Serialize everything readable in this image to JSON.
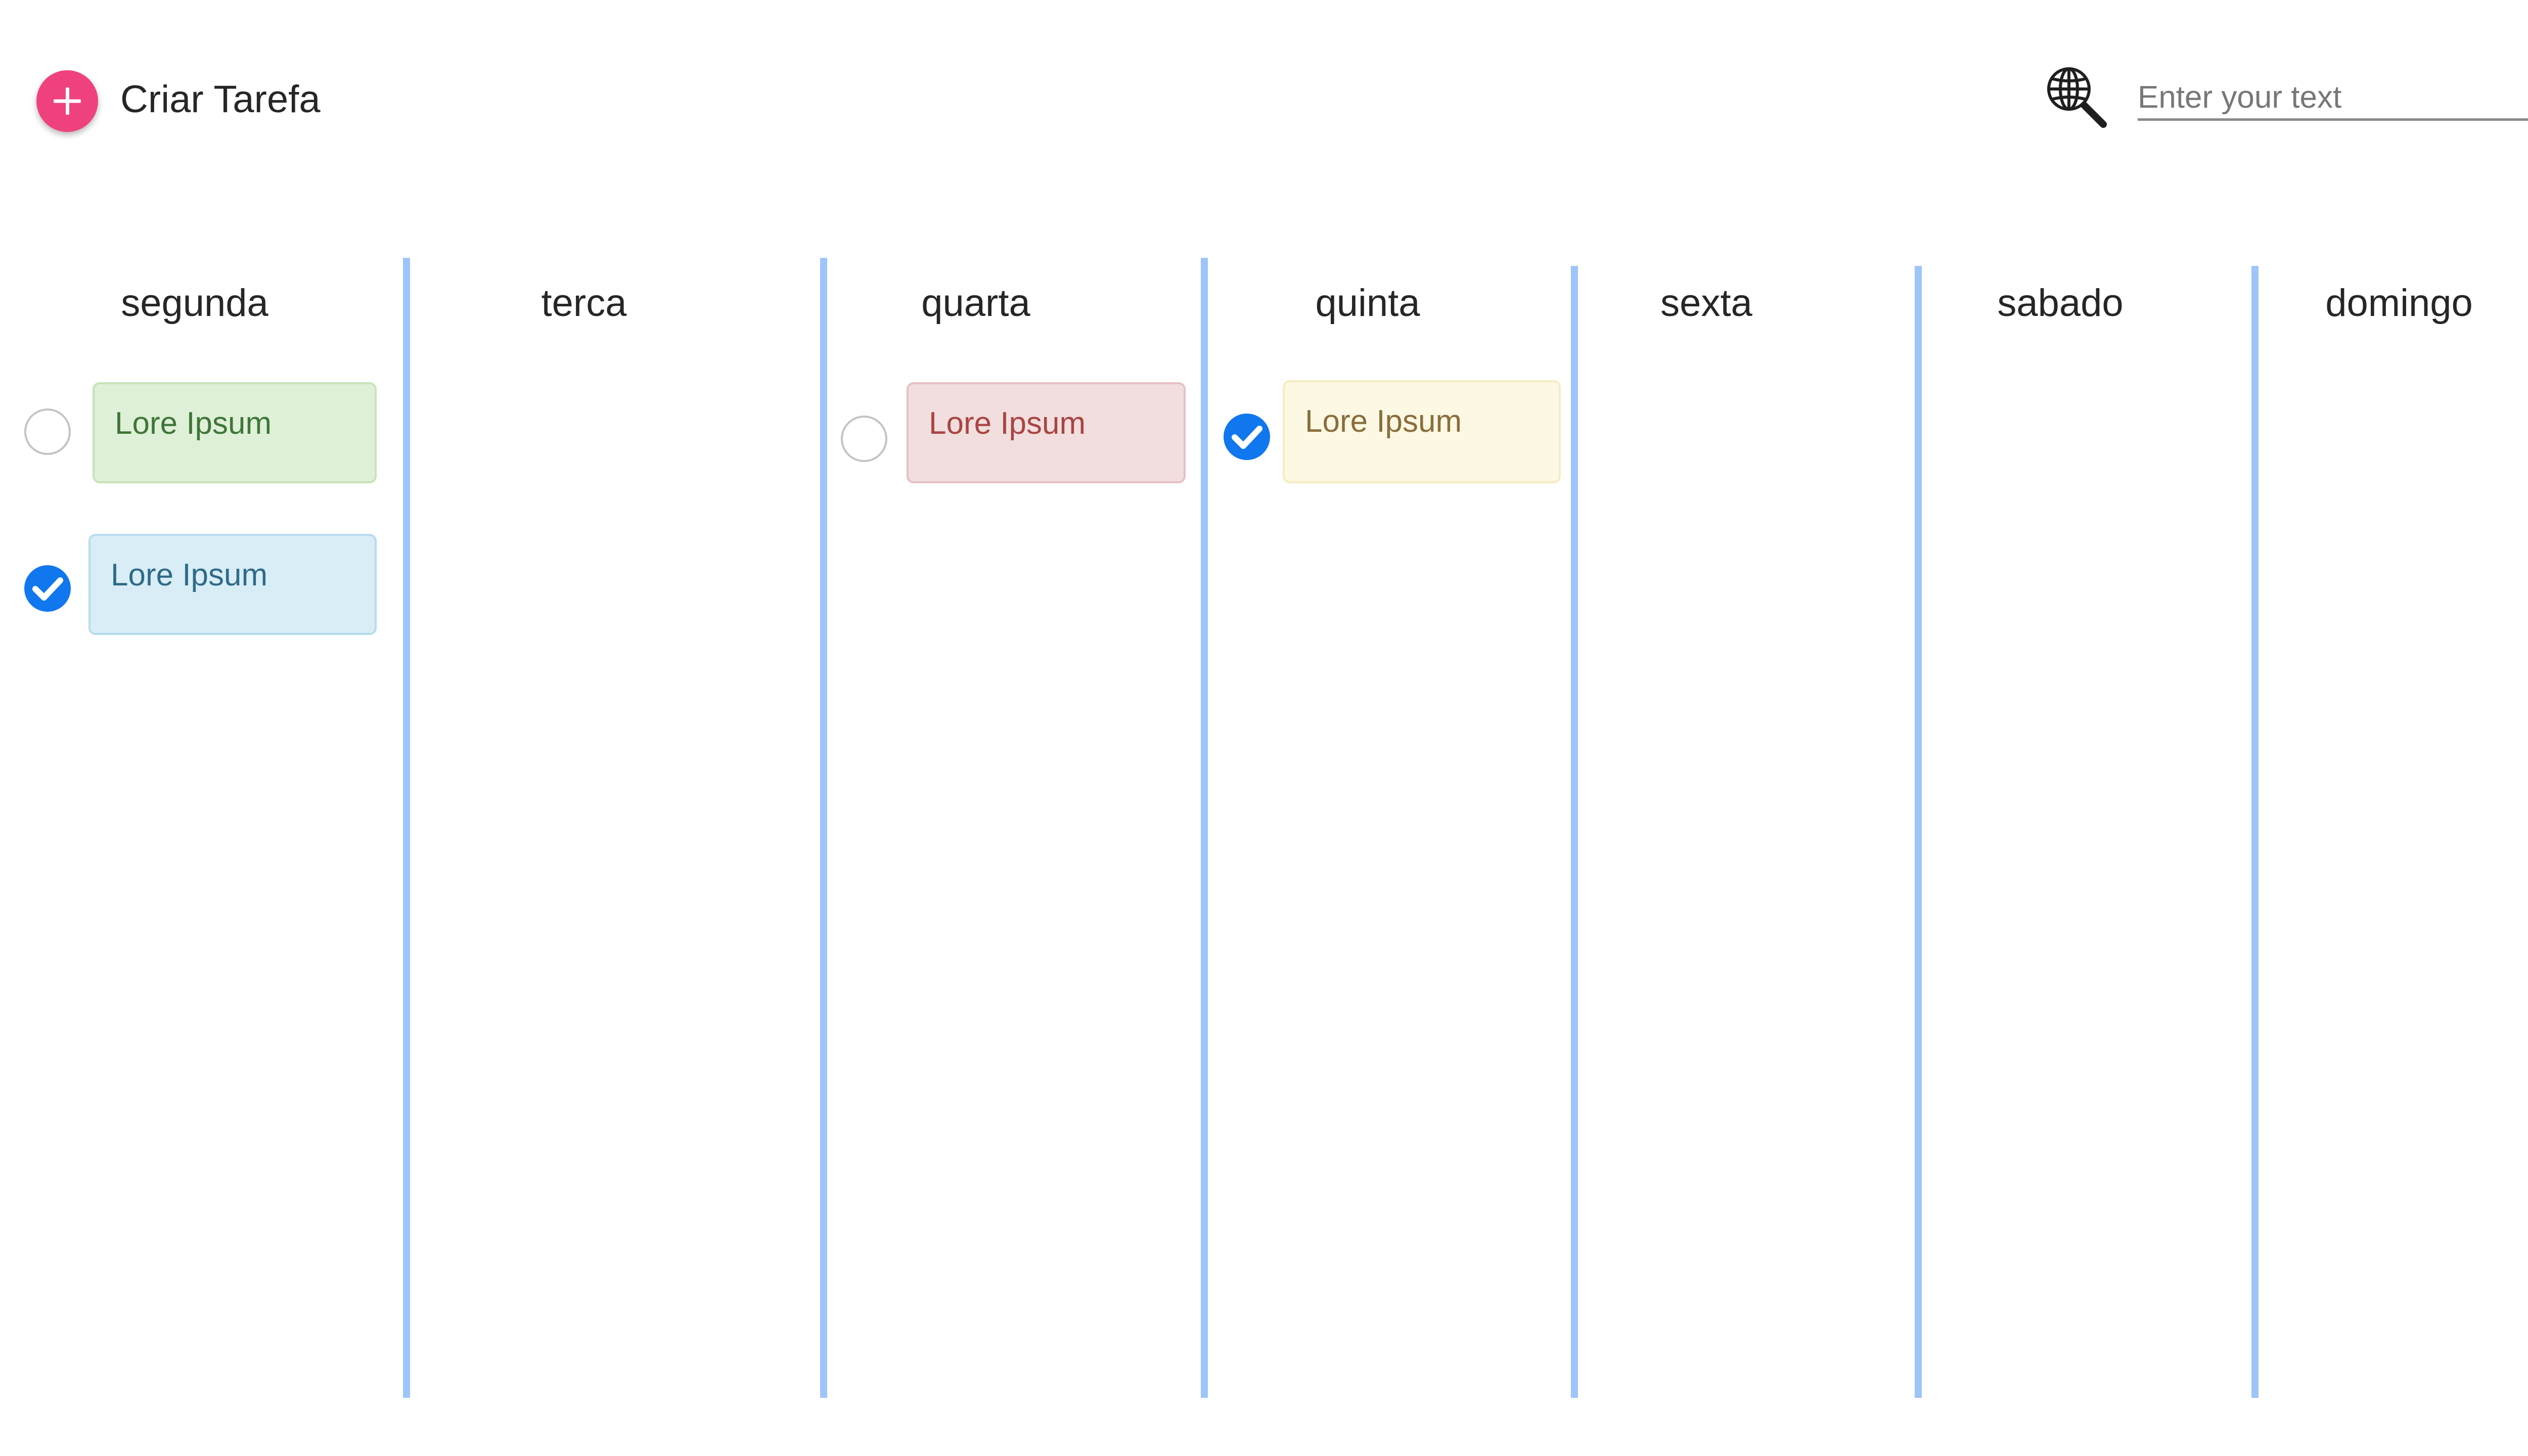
{
  "header": {
    "create_task_label": "Criar Tarefa",
    "create_icon": "plus-icon",
    "search_icon": "globe-search-icon",
    "search_placeholder": "Enter your text",
    "search_value": ""
  },
  "colors": {
    "accent": "#f0417f",
    "divider": "#9ec5f9",
    "checkbox_checked": "#1177ee"
  },
  "days": [
    {
      "label": "segunda"
    },
    {
      "label": "terca"
    },
    {
      "label": "quarta"
    },
    {
      "label": "quinta"
    },
    {
      "label": "sexta"
    },
    {
      "label": "sabado"
    },
    {
      "label": "domingo"
    }
  ],
  "tasks": {
    "segunda": [
      {
        "text": "Lore Ipsum",
        "done": false,
        "color": "green"
      },
      {
        "text": "Lore Ipsum",
        "done": true,
        "color": "blue"
      }
    ],
    "quarta": [
      {
        "text": "Lore Ipsum",
        "done": false,
        "color": "red"
      }
    ],
    "quinta": [
      {
        "text": "Lore Ipsum",
        "done": true,
        "color": "yellow"
      }
    ]
  }
}
